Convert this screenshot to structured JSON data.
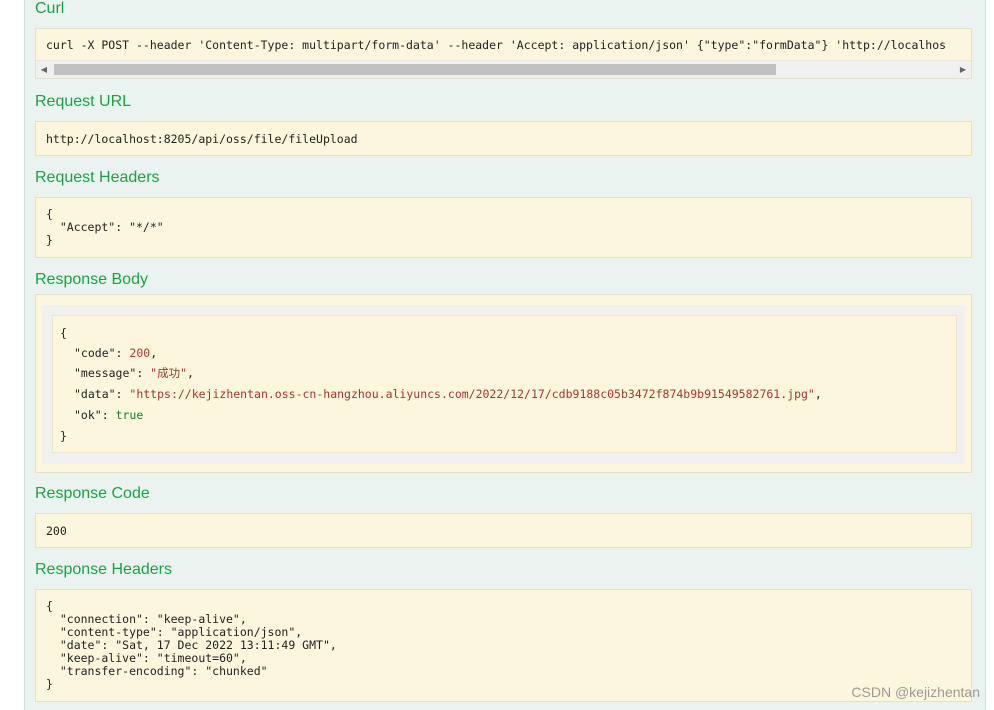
{
  "curl": {
    "title": "Curl",
    "command": "curl -X POST --header 'Content-Type: multipart/form-data' --header 'Accept: application/json' {\"type\":\"formData\"} 'http://localhos"
  },
  "request_url": {
    "title": "Request URL",
    "value": "http://localhost:8205/api/oss/file/fileUpload"
  },
  "request_headers": {
    "title": "Request Headers",
    "lines": [
      "{",
      "  \"Accept\": \"*/*\"",
      "}"
    ]
  },
  "response_body": {
    "title": "Response Body",
    "open": "{",
    "close": "}",
    "code_key": "\"code\"",
    "code_val": "200",
    "message_key": "\"message\"",
    "message_val": "\"成功\"",
    "data_key": "\"data\"",
    "data_val": "\"https://kejizhentan.oss-cn-hangzhou.aliyuncs.com/2022/12/17/cdb9188c05b3472f874b9b91549582761.jpg\"",
    "ok_key": "\"ok\"",
    "ok_val": "true"
  },
  "response_code": {
    "title": "Response Code",
    "value": "200"
  },
  "response_headers": {
    "title": "Response Headers",
    "lines": [
      "{",
      "  \"connection\": \"keep-alive\",",
      "  \"content-type\": \"application/json\",",
      "  \"date\": \"Sat, 17 Dec 2022 13:11:49 GMT\",",
      "  \"keep-alive\": \"timeout=60\",",
      "  \"transfer-encoding\": \"chunked\"",
      "}"
    ]
  },
  "watermark": "CSDN @kejizhentan",
  "icons": {
    "scroll_left": "scroll-left-arrow-icon",
    "scroll_right": "scroll-right-arrow-icon"
  },
  "colors": {
    "section_title": "#1ba245",
    "box_bg": "#fcf6dc",
    "panel_bg": "#ebf3f0",
    "json_number": "#a3382e",
    "json_bool": "#1b7a2e"
  }
}
